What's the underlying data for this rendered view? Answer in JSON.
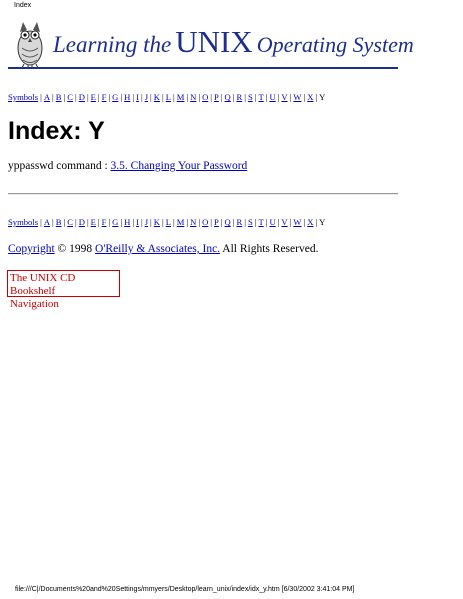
{
  "page_header": "Index",
  "banner": {
    "title_part1": "Learning the",
    "title_part2": "UNIX",
    "title_part3": "Operating System"
  },
  "alpha_nav": {
    "items": [
      "Symbols",
      "A",
      "B",
      "C",
      "D",
      "E",
      "F",
      "G",
      "H",
      "I",
      "J",
      "K",
      "L",
      "M",
      "N",
      "O",
      "P",
      "Q",
      "R",
      "S",
      "T",
      "U",
      "V",
      "W",
      "X"
    ],
    "current": "Y"
  },
  "page_title": "Index: Y",
  "entry": {
    "term": "yppasswd command : ",
    "link": "3.5. Changing Your Password"
  },
  "copyright": {
    "link1": "Copyright",
    "text1": " © 1998 ",
    "link2": "O'Reilly & Associates, Inc.",
    "text2": " All Rights Reserved."
  },
  "bookshelf": {
    "line1": "The UNIX CD Bookshelf",
    "line2": "Navigation"
  },
  "page_footer": "file:///C|/Documents%20and%20Settings/mmyers/Desktop/learn_unix/index/idx_y.htm [6/30/2002 3:41:04 PM]",
  "colors": {
    "banner_blue": "#1c2f8f",
    "link": "#0000cc",
    "bookshelf_red": "#cc0000"
  }
}
